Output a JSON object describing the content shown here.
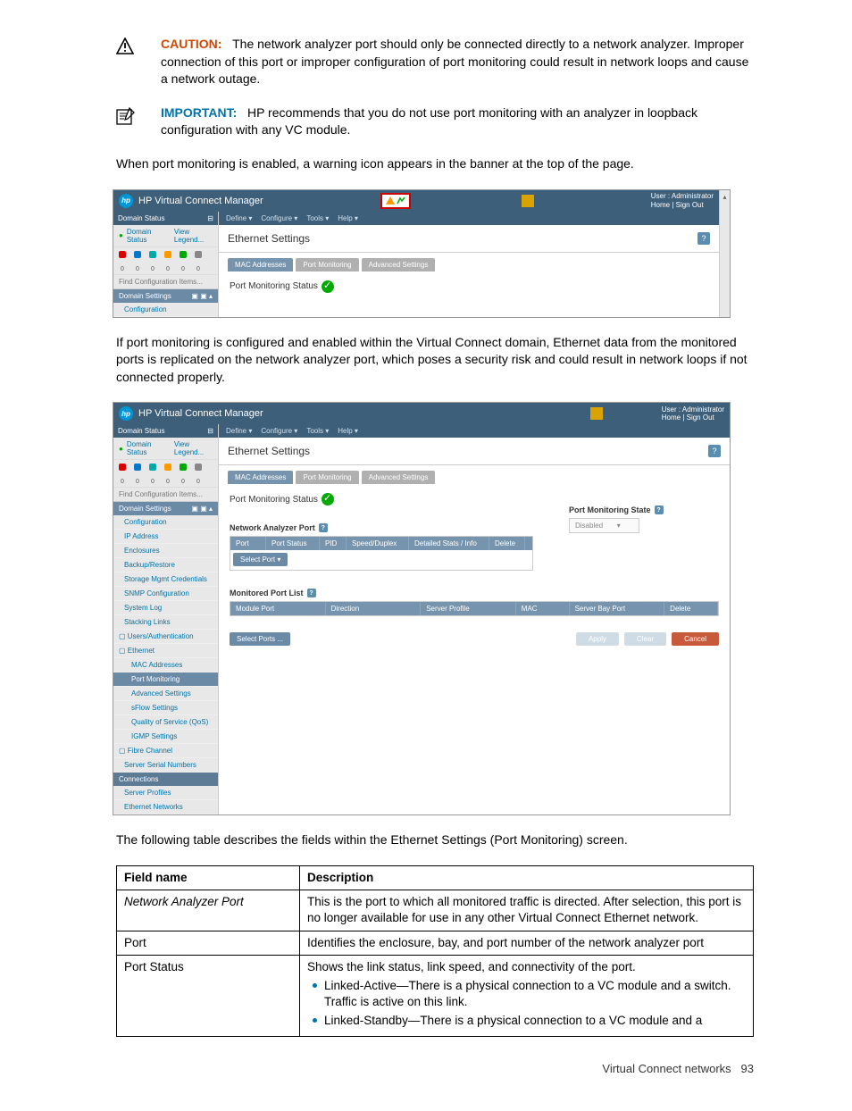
{
  "alerts": {
    "caution": {
      "label": "CAUTION:",
      "text": "The network analyzer port should only be connected directly to a network analyzer. Improper connection of this port or improper configuration of port monitoring could result in network loops and cause a network outage."
    },
    "important": {
      "label": "IMPORTANT:",
      "text": "HP recommends that you do not use port monitoring with an analyzer in loopback configuration with any VC module."
    }
  },
  "paragraphs": {
    "p1": "When port monitoring is enabled, a warning icon appears in the banner at the top of the page.",
    "p2": "If port monitoring is configured and enabled within the Virtual Connect domain, Ethernet data from the monitored ports is replicated on the network analyzer port, which poses a security risk and could result in network loops if not connected properly.",
    "p3": "The following table describes the fields within the Ethernet Settings (Port Monitoring) screen."
  },
  "app": {
    "title": "HP Virtual Connect Manager",
    "user_label": "User : Administrator",
    "links": "Home | Sign Out",
    "menu": {
      "define": "Define ▾",
      "configure": "Configure ▾",
      "tools": "Tools ▾",
      "help": "Help ▾"
    },
    "sidebar": {
      "header": "Domain Status",
      "status_link": "Domain Status",
      "view_legend": "View Legend...",
      "find": "Find Configuration Items...",
      "domain_settings": "Domain Settings",
      "items": {
        "configuration": "Configuration",
        "ip_address": "IP Address",
        "enclosures": "Enclosures",
        "backup": "Backup/Restore",
        "storage": "Storage Mgmt Credentials",
        "snmp": "SNMP Configuration",
        "syslog": "System Log",
        "stacking": "Stacking Links",
        "users": "Users/Authentication",
        "ethernet": "Ethernet",
        "mac": "MAC Addresses",
        "port_monitoring": "Port Monitoring",
        "advanced": "Advanced Settings",
        "sflow": "sFlow Settings",
        "qos": "Quality of Service (QoS)",
        "igmp": "IGMP Settings",
        "fibre": "Fibre Channel",
        "serial": "Server Serial Numbers",
        "connections": "Connections",
        "profiles": "Server Profiles",
        "eth_networks": "Ethernet Networks"
      }
    },
    "main": {
      "title": "Ethernet Settings",
      "tabs": {
        "mac": "MAC Addresses",
        "portmon": "Port Monitoring",
        "advanced": "Advanced Settings"
      },
      "pm_status": "Port Monitoring Status",
      "nap_label": "Network Analyzer Port",
      "nap_cols": {
        "port": "Port",
        "status": "Port Status",
        "pid": "PID",
        "speed": "Speed/Duplex",
        "detail": "Detailed Stats / Info",
        "delete": "Delete"
      },
      "select_port": "Select Port ▾",
      "pm_state_label": "Port Monitoring State",
      "pm_state_value": "Disabled",
      "mpl_label": "Monitored Port List",
      "mpl_cols": {
        "module": "Module Port",
        "direction": "Direction",
        "profile": "Server Profile",
        "mac": "MAC",
        "bay": "Server Bay Port",
        "delete": "Delete"
      },
      "select_ports": "Select Ports ...",
      "btn_apply": "Apply",
      "btn_clear": "Clear",
      "btn_cancel": "Cancel"
    }
  },
  "table": {
    "h1": "Field name",
    "h2": "Description",
    "rows": {
      "r1": {
        "field": "Network Analyzer Port",
        "desc": "This is the port to which all monitored traffic is directed. After selection, this port is no longer available for use in any other Virtual Connect Ethernet network."
      },
      "r2": {
        "field": "Port",
        "desc": "Identifies the enclosure, bay, and port number of the network analyzer port"
      },
      "r3": {
        "field": "Port Status",
        "desc_intro": "Shows the link status, link speed, and connectivity of the port.",
        "b1": "Linked-Active—There is a physical connection to a VC module and a switch. Traffic is active on this link.",
        "b2": "Linked-Standby—There is a physical connection to a VC module and a"
      }
    }
  },
  "footer": {
    "text": "Virtual Connect networks",
    "page": "93"
  }
}
